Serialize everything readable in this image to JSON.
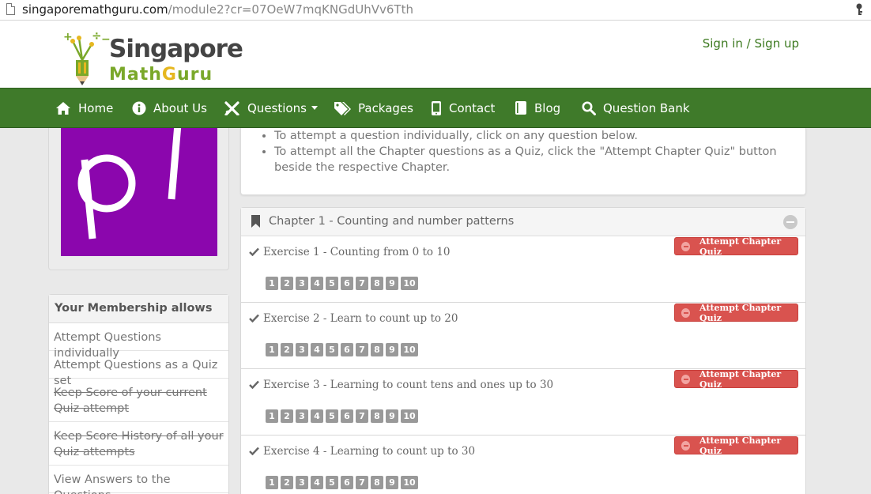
{
  "browser": {
    "url_host": "singaporemathguru.com",
    "url_path": "/module2?cr=07OeW7mqKNGdUhVv6Tth"
  },
  "header": {
    "logo_word1": "Singapore",
    "logo_word2_a": "Math",
    "logo_word2_b": "G",
    "logo_word2_c": "uru",
    "sign_link": "Sign in / Sign up"
  },
  "nav": {
    "items": [
      {
        "label": "Home",
        "icon": "home-icon"
      },
      {
        "label": "About Us",
        "icon": "info-icon"
      },
      {
        "label": "Questions",
        "icon": "tools-icon"
      },
      {
        "label": "Packages",
        "icon": "tags-icon"
      },
      {
        "label": "Contact",
        "icon": "phone-icon"
      },
      {
        "label": "Blog",
        "icon": "book-icon"
      },
      {
        "label": "Question Bank",
        "icon": "search-icon"
      }
    ]
  },
  "avatar": {
    "letters": "p l",
    "color": "#8b06ad"
  },
  "membership": {
    "title": "Your Membership allows",
    "items": [
      {
        "text": "Attempt Questions individually",
        "struck": false
      },
      {
        "text": "Attempt Questions as a Quiz set",
        "struck": false
      },
      {
        "text": "Keep Score of your current Quiz attempt",
        "struck": true
      },
      {
        "text": "Keep Score History of all your Quiz attempts",
        "struck": true
      },
      {
        "text": "View Answers to the Questions",
        "struck": false
      }
    ]
  },
  "instructions": {
    "items": [
      "To attempt a question individually, click on any question below.",
      "To attempt all the Chapter questions as a Quiz, click the \"Attempt Chapter Quiz\" button beside the respective Chapter."
    ]
  },
  "chapter": {
    "title": "Chapter 1 - Counting and number patterns",
    "quiz_label": "Attempt Chapter Quiz",
    "exercises": [
      {
        "title": "Exercise 1 - Counting from 0 to 10",
        "questions": [
          "1",
          "2",
          "3",
          "4",
          "5",
          "6",
          "7",
          "8",
          "9",
          "10"
        ]
      },
      {
        "title": "Exercise 2 - Learn to count up to 20",
        "questions": [
          "1",
          "2",
          "3",
          "4",
          "5",
          "6",
          "7",
          "8",
          "9",
          "10"
        ]
      },
      {
        "title": "Exercise 3 - Learning to count tens and ones up to 30",
        "questions": [
          "1",
          "2",
          "3",
          "4",
          "5",
          "6",
          "7",
          "8",
          "9",
          "10"
        ]
      },
      {
        "title": "Exercise 4 - Learning to count up to 30",
        "questions": [
          "1",
          "2",
          "3",
          "4",
          "5",
          "6",
          "7",
          "8",
          "9",
          "10"
        ]
      }
    ]
  },
  "colors": {
    "nav_bg": "#3f7a2a",
    "quiz_button": "#d9534f",
    "question_badge": "#999999",
    "link_green": "#3d7a20"
  }
}
